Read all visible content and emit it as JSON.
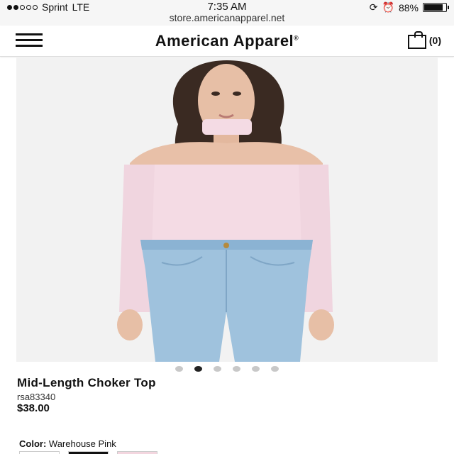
{
  "status_bar": {
    "carrier": "Sprint",
    "network": "LTE",
    "time": "7:35 AM",
    "url": "store.americanapparel.net",
    "battery": "88%",
    "battery_level": 0.88
  },
  "header": {
    "brand": "American Apparel",
    "brand_mark": "®",
    "cart_count": "(0)"
  },
  "carousel": {
    "total": 6,
    "active_index": 1
  },
  "product": {
    "title": "Mid-Length Choker Top",
    "sku": "rsa83340",
    "price": "$38.00",
    "color_label": "Color:",
    "color_value": "Warehouse Pink"
  },
  "swatches": [
    {
      "name": "white",
      "color": "#ffffff"
    },
    {
      "name": "black",
      "color": "#111111"
    },
    {
      "name": "warehouse-pink",
      "color": "#f3d6df"
    }
  ],
  "colors": {
    "top_pink": "#f4dbe4",
    "denim": "#9fc2dd",
    "skin": "#e8c0a8",
    "hair": "#3a2a22",
    "background": "#f1f1f1"
  }
}
